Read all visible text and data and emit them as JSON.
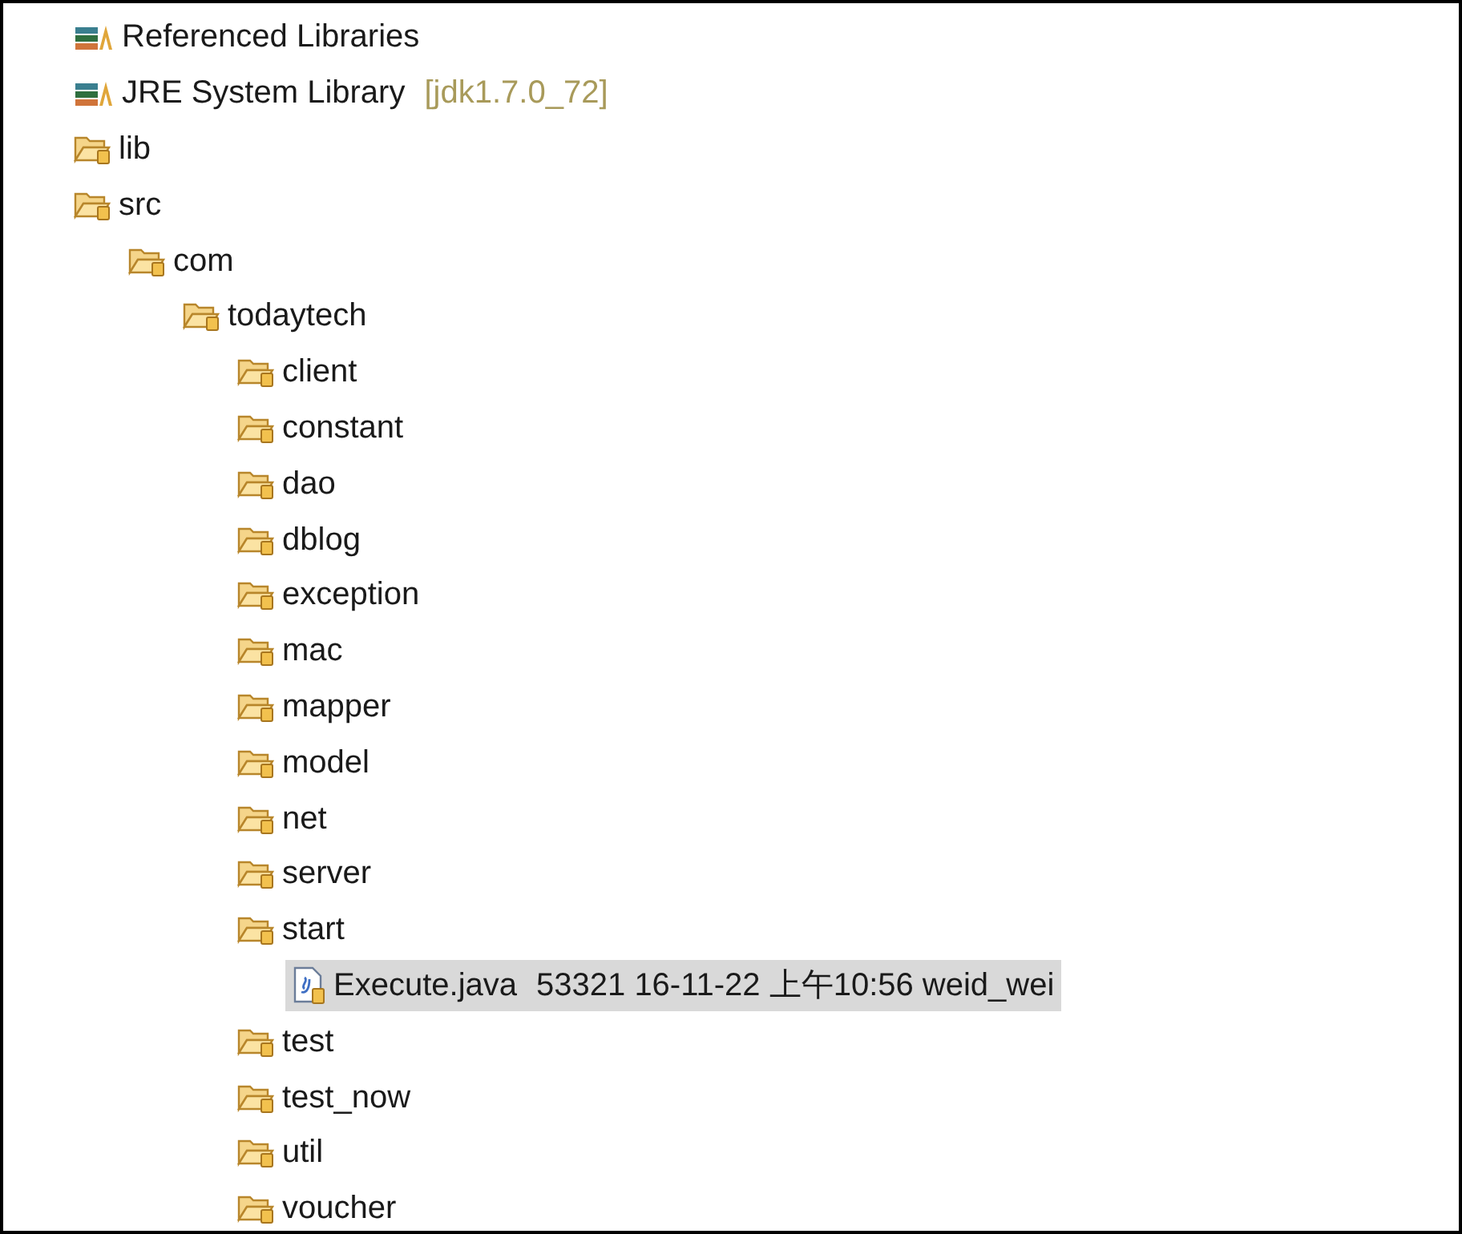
{
  "tree": [
    {
      "kind": "library",
      "label": "Referenced Libraries",
      "selected": false
    },
    {
      "kind": "library",
      "label": "JRE System Library",
      "suffix": "[jdk1.7.0_72]",
      "selected": false
    },
    {
      "kind": "folder",
      "label": "lib",
      "selected": false
    },
    {
      "kind": "folder",
      "label": "src",
      "selected": false,
      "children": [
        {
          "kind": "folder",
          "label": "com",
          "selected": false,
          "children": [
            {
              "kind": "folder",
              "label": "todaytech",
              "selected": false,
              "children": [
                {
                  "kind": "folder",
                  "label": "client",
                  "selected": false
                },
                {
                  "kind": "folder",
                  "label": "constant",
                  "selected": false
                },
                {
                  "kind": "folder",
                  "label": "dao",
                  "selected": false
                },
                {
                  "kind": "folder",
                  "label": "dblog",
                  "selected": false
                },
                {
                  "kind": "folder",
                  "label": "exception",
                  "selected": false
                },
                {
                  "kind": "folder",
                  "label": "mac",
                  "selected": false
                },
                {
                  "kind": "folder",
                  "label": "mapper",
                  "selected": false
                },
                {
                  "kind": "folder",
                  "label": "model",
                  "selected": false
                },
                {
                  "kind": "folder",
                  "label": "net",
                  "selected": false
                },
                {
                  "kind": "folder",
                  "label": "server",
                  "selected": false
                },
                {
                  "kind": "folder",
                  "label": "start",
                  "selected": false,
                  "children": [
                    {
                      "kind": "file",
                      "label": "Execute.java",
                      "suffix": "53321  16-11-22 上午10:56  weid_wei",
                      "selected": true
                    }
                  ]
                },
                {
                  "kind": "folder",
                  "label": "test",
                  "selected": false
                },
                {
                  "kind": "folder",
                  "label": "test_now",
                  "selected": false
                },
                {
                  "kind": "folder",
                  "label": "util",
                  "selected": false
                },
                {
                  "kind": "folder",
                  "label": "voucher",
                  "selected": false
                }
              ]
            }
          ]
        }
      ]
    }
  ]
}
